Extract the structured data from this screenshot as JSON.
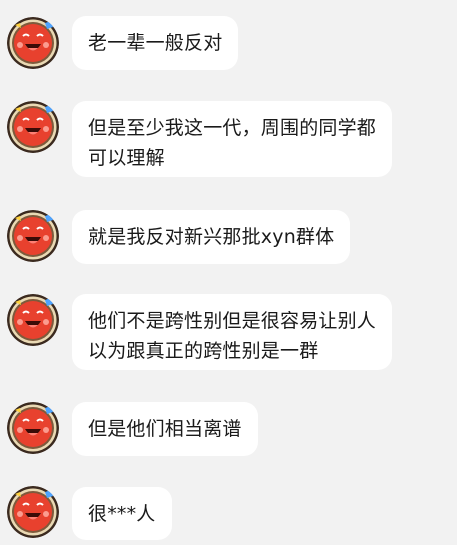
{
  "messages": [
    {
      "lines": [
        "老一辈一般反对"
      ]
    },
    {
      "lines": [
        "但是至少我这一代，周围的同学都",
        "可以理解"
      ]
    },
    {
      "lines": [
        "就是我反对新兴那批xyn群体"
      ]
    },
    {
      "lines": [
        "他们不是跨性别但是很容易让别人",
        "以为跟真正的跨性别是一群"
      ]
    },
    {
      "lines": [
        "但是他们相当离谱"
      ]
    },
    {
      "lines": [
        "很***人"
      ]
    }
  ],
  "avatar_icon": "taiko-drum-don-icon",
  "colors": {
    "background": "#f2f2f2",
    "bubble": "#ffffff",
    "text": "#1a1a1a",
    "avatar_red": "#e8412e"
  }
}
